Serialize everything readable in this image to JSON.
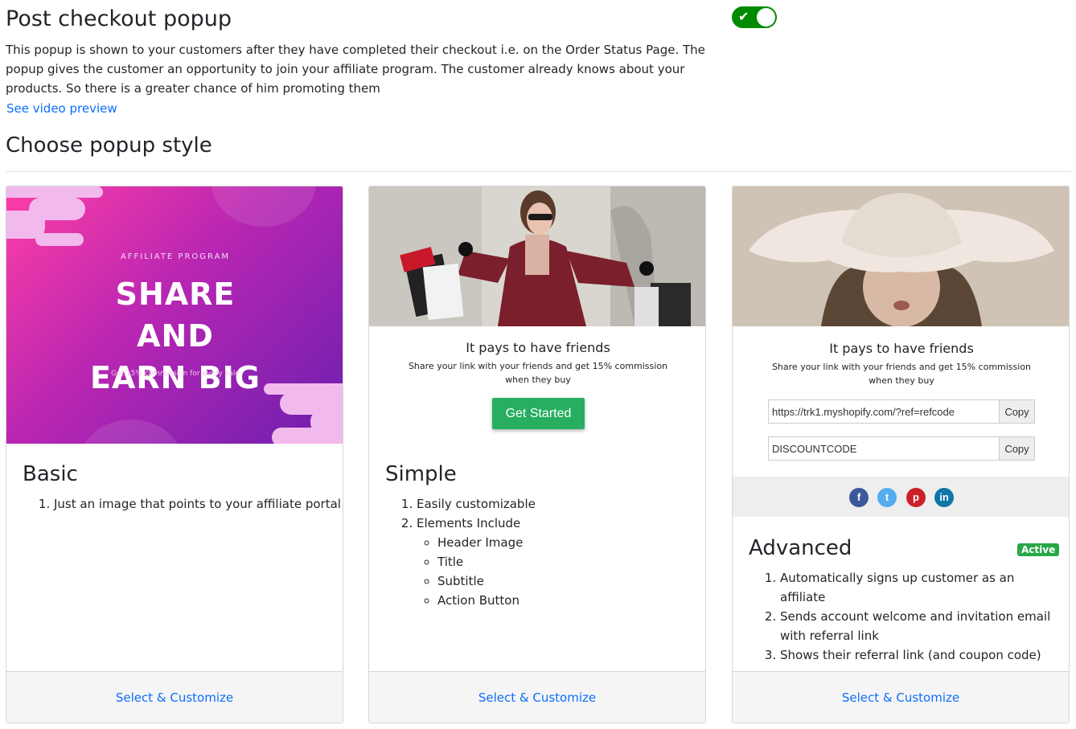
{
  "header": {
    "title": "Post checkout popup",
    "description": "This popup is shown to your customers after they have completed their checkout i.e. on the Order Status Page. The popup gives the customer an opportunity to join your affiliate program. The customer already knows about your products. So there is a greater chance of him promoting them",
    "video_link": "See video preview",
    "toggle_on": true,
    "toggle_icon": "check-icon"
  },
  "section": {
    "title": "Choose popup style"
  },
  "cards": [
    {
      "name": "Basic",
      "preview": {
        "kicker": "AFFILIATE PROGRAM",
        "line1": "SHARE",
        "line2": "AND",
        "line3": "EARN BIG",
        "small": "Get 15% commission for every sale"
      },
      "features": [
        "Just an image that points to your affiliate portal"
      ],
      "action": "Select & Customize"
    },
    {
      "name": "Simple",
      "preview": {
        "title": "It pays to have friends",
        "sub1": "Share your link with your friends and get 15% commission",
        "sub2": "when they buy",
        "button": "Get Started"
      },
      "features": [
        "Easily customizable",
        "Elements Include"
      ],
      "sub_features": [
        "Header Image",
        "Title",
        "Subtitle",
        "Action Button"
      ],
      "action": "Select & Customize"
    },
    {
      "name": "Advanced",
      "badge": "Active",
      "preview": {
        "title": "It pays to have friends",
        "sub1": "Share your link with your friends and get 15% commission",
        "sub2": "when they buy",
        "link_value": "https://trk1.myshopify.com/?ref=refcode",
        "code_value": "DISCOUNTCODE",
        "copy_label": "Copy",
        "social": [
          "facebook-icon",
          "twitter-icon",
          "pinterest-icon",
          "linkedin-icon"
        ]
      },
      "features": [
        "Automatically signs up customer as an affiliate",
        "Sends account welcome and invitation email with referral link",
        "Shows their referral link (and coupon code)"
      ],
      "action": "Select & Customize"
    }
  ],
  "colors": {
    "accent": "#0d6efd",
    "toggle": "#008a00",
    "get_started": "#27ae60",
    "badge": "#28a745"
  }
}
